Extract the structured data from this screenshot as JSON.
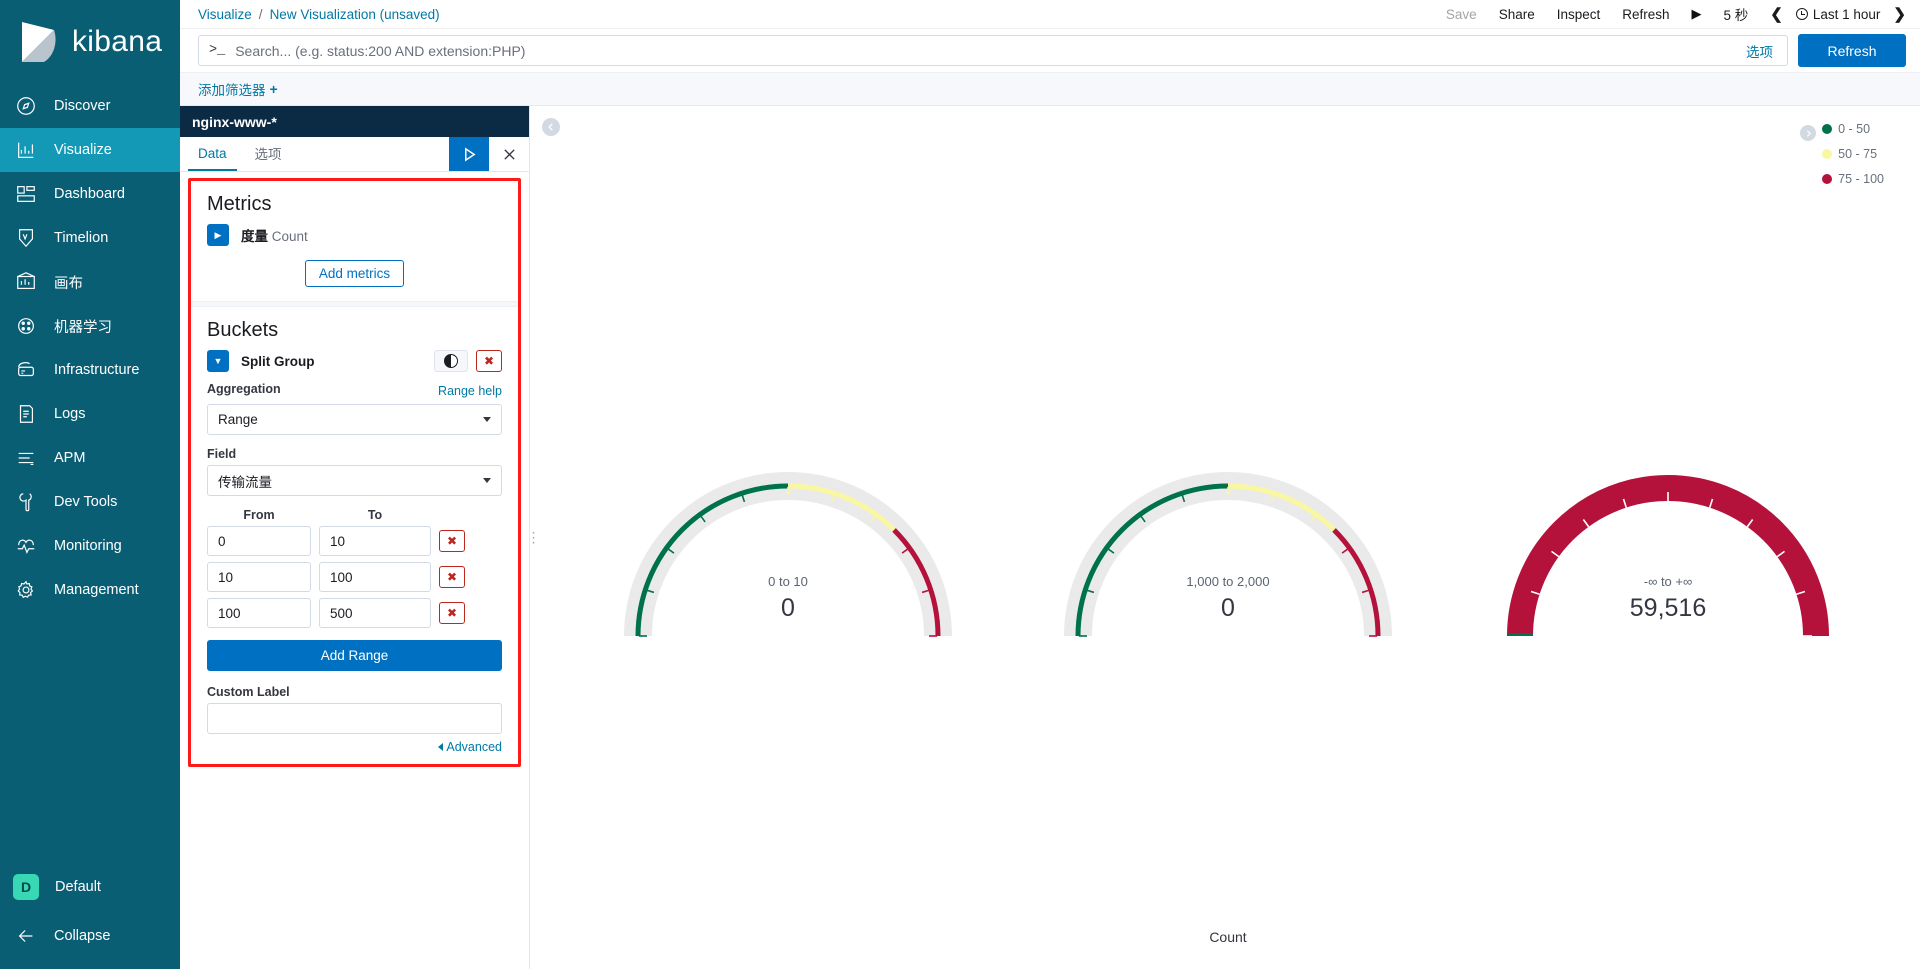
{
  "brand": {
    "name": "kibana"
  },
  "sidebar": {
    "items": [
      {
        "label": "Discover",
        "icon": "compass-icon",
        "active": false
      },
      {
        "label": "Visualize",
        "icon": "bar-chart-icon",
        "active": true
      },
      {
        "label": "Dashboard",
        "icon": "dashboard-icon",
        "active": false
      },
      {
        "label": "Timelion",
        "icon": "timelion-icon",
        "active": false
      },
      {
        "label": "画布",
        "icon": "canvas-icon",
        "active": false
      },
      {
        "label": "机器学习",
        "icon": "machine-learning-icon",
        "active": false
      },
      {
        "label": "Infrastructure",
        "icon": "infrastructure-icon",
        "active": false
      },
      {
        "label": "Logs",
        "icon": "logs-icon",
        "active": false
      },
      {
        "label": "APM",
        "icon": "apm-icon",
        "active": false
      },
      {
        "label": "Dev Tools",
        "icon": "wrench-icon",
        "active": false
      },
      {
        "label": "Monitoring",
        "icon": "monitoring-icon",
        "active": false
      },
      {
        "label": "Management",
        "icon": "gear-icon",
        "active": false
      }
    ],
    "space": {
      "badge": "D",
      "label": "Default"
    },
    "collapse": {
      "label": "Collapse",
      "icon": "arrow-left-icon"
    }
  },
  "topbar": {
    "breadcrumb_root": "Visualize",
    "breadcrumb_sep": "/",
    "breadcrumb_current": "New Visualization (unsaved)",
    "save": "Save",
    "share": "Share",
    "inspect": "Inspect",
    "refresh": "Refresh",
    "play_icon": "play-icon",
    "interval": "5 秒",
    "prev_icon": "chevron-left-icon",
    "clock_icon": "clock-icon",
    "time_range": "Last 1 hour",
    "next_icon": "chevron-right-icon"
  },
  "query": {
    "prompt": ">_",
    "placeholder": "Search... (e.g. status:200 AND extension:PHP)",
    "value": "",
    "options_label": "选项",
    "refresh_button": "Refresh"
  },
  "filters": {
    "add_label": "添加筛选器",
    "plus_icon": "plus-icon"
  },
  "editor": {
    "index_pattern": "nginx-www-*",
    "tabs": [
      {
        "label": "Data",
        "active": true
      },
      {
        "label": "选项",
        "active": false
      }
    ],
    "apply_icon": "play-triangle-icon",
    "close_icon": "close-icon",
    "metrics": {
      "title": "Metrics",
      "items": [
        {
          "toggle_icon": "chevron-right-icon",
          "prefix": "度量",
          "value": "Count"
        }
      ],
      "add_button": "Add metrics"
    },
    "buckets": {
      "title": "Buckets",
      "bucket": {
        "toggle_icon": "chevron-down-icon",
        "name": "Split Group",
        "toggle_enabled_icon": "circle-toggle-icon",
        "remove_icon": "remove-x-icon",
        "aggregation_label": "Aggregation",
        "help_link": "Range help",
        "aggregation_value": "Range",
        "field_label": "Field",
        "field_value": "传输流量",
        "from_header": "From",
        "to_header": "To",
        "ranges": [
          {
            "from": "0",
            "to": "10"
          },
          {
            "from": "10",
            "to": "100"
          },
          {
            "from": "100",
            "to": "500"
          }
        ],
        "add_range_button": "Add Range",
        "custom_label_label": "Custom Label",
        "custom_label_value": "",
        "advanced_link": "Advanced"
      }
    }
  },
  "chart": {
    "collapse_icon": "chevron-left-icon",
    "legend_toggle_icon": "chevron-right-icon",
    "xlabel": "Count",
    "colors": {
      "green": "#00724b",
      "yellow": "#f9f7a1",
      "crimson": "#b4123b",
      "track": "#eaeaea"
    }
  },
  "chart_data": {
    "type": "gauge",
    "title": "",
    "xlabel": "Count",
    "legend_position": "top-right",
    "legend": [
      {
        "label": "0 - 50",
        "color": "#00724b"
      },
      {
        "label": "50 - 75",
        "color": "#f9f7a1"
      },
      {
        "label": "75 - 100",
        "color": "#b4123b"
      }
    ],
    "bands": [
      {
        "from": 0,
        "to": 50,
        "color": "#00724b"
      },
      {
        "from": 50,
        "to": 75,
        "color": "#f9f7a1"
      },
      {
        "from": 75,
        "to": 100,
        "color": "#b4123b"
      }
    ],
    "gauges": [
      {
        "label": "0 to 10",
        "value": 0,
        "display": "0",
        "percent": 0,
        "full": false
      },
      {
        "label": "1,000 to 2,000",
        "value": 0,
        "display": "0",
        "percent": 0,
        "full": false
      },
      {
        "label": "-∞ to +∞",
        "value": 59516,
        "display": "59,516",
        "percent": 100,
        "full": true
      }
    ]
  }
}
